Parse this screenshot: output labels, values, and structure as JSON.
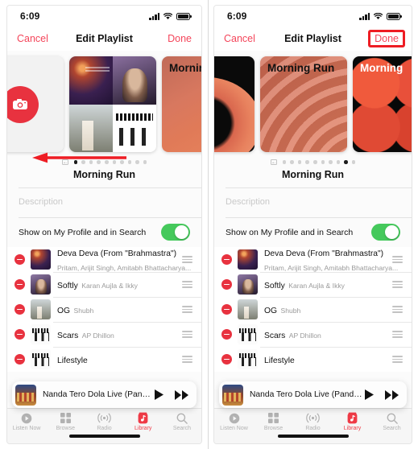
{
  "theme": {
    "accent_red": "#f4455a",
    "highlight_red": "#ee1d24",
    "toggle_green": "#45c95c",
    "remove_red": "#e8323f"
  },
  "status_bar": {
    "time": "6:09",
    "signal_icon": "cellular-bars-icon",
    "wifi_icon": "wifi-icon",
    "battery_icon": "battery-icon"
  },
  "navbar": {
    "cancel_label": "Cancel",
    "title": "Edit Playlist",
    "done_label": "Done"
  },
  "carousel": {
    "camera_icon": "camera-icon",
    "photo_dot_icon": "photo-icon",
    "total_dots": 10,
    "left_active_index": 1,
    "right_active_index": 9,
    "left_cards": [
      {
        "name": "choose-photo-card",
        "kind": "camera",
        "title": ""
      },
      {
        "name": "album-collage-card",
        "kind": "collage",
        "title": ""
      },
      {
        "name": "artwork-warm-gradient-card",
        "kind": "g-warm",
        "title": "Morning Run",
        "title_color": "dark"
      }
    ],
    "right_cards": [
      {
        "name": "artwork-black-radial-card",
        "kind": "g-black",
        "title": "g Run",
        "title_color": "light"
      },
      {
        "name": "artwork-rays-card",
        "kind": "g-rays",
        "title": "Morning Run",
        "title_color": "dark"
      },
      {
        "name": "artwork-circles-card",
        "kind": "g-circles",
        "title": "Morning",
        "title_color": "light"
      }
    ]
  },
  "annotations": {
    "left_arrow": "red-left-arrow",
    "done_highlight": "red-rectangle-around-done"
  },
  "details": {
    "playlist_title": "Morning Run",
    "description_placeholder": "Description",
    "description_value": "",
    "share_label": "Show on My Profile and in Search",
    "share_enabled": true
  },
  "tracks": [
    {
      "name": "Deva Deva (From \"Brahmastra\")",
      "artist": "Pritam, Arijit Singh, Amitabh Bhattacharya...",
      "art": "t-deva"
    },
    {
      "name": "Softly",
      "artist": "Karan Aujla & Ikky",
      "art": "t-softly"
    },
    {
      "name": "OG",
      "artist": "Shubh",
      "art": "t-og"
    },
    {
      "name": "Scars",
      "artist": "AP Dhillon",
      "art": "t-scars"
    },
    {
      "name": "Lifestyle",
      "artist": "",
      "art": "t-scars"
    }
  ],
  "mini_player": {
    "title": "Nanda Tero Dola Live (Pandavaas)",
    "play_icon": "play-icon",
    "forward_icon": "fast-forward-icon",
    "artwork": "mini-player-artwork"
  },
  "tabbar": {
    "items": [
      {
        "label": "Listen Now",
        "icon": "play-circle-icon",
        "active": false
      },
      {
        "label": "Browse",
        "icon": "grid-icon",
        "active": false
      },
      {
        "label": "Radio",
        "icon": "radio-waves-icon",
        "active": false
      },
      {
        "label": "Library",
        "icon": "library-icon",
        "active": true
      },
      {
        "label": "Search",
        "icon": "search-icon",
        "active": false
      }
    ]
  }
}
